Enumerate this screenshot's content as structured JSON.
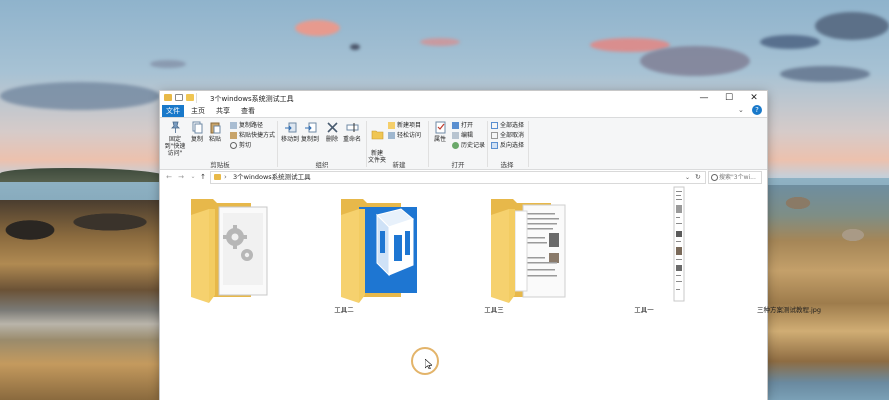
{
  "window": {
    "title": "3个windows系统测试工具",
    "controls": {
      "minimize": "—",
      "maximize": "☐",
      "close": "✕"
    }
  },
  "ribbon_tabs": {
    "file": "文件",
    "home": "主页",
    "share": "共享",
    "view": "查看",
    "expand": "⌄",
    "help": "?"
  },
  "ribbon": {
    "clipboard": {
      "group_label": "剪贴板",
      "pin_quick_access": "固定到\"快速访问\"",
      "copy": "复制",
      "paste": "粘贴",
      "copy_path": "复制路径",
      "paste_shortcut": "粘贴快捷方式",
      "cut": "剪切"
    },
    "organize": {
      "group_label": "组织",
      "move_to": "移动到",
      "copy_to": "复制到",
      "delete": "删除",
      "rename": "重命名"
    },
    "new": {
      "group_label": "新建",
      "new_folder": "新建\n文件夹",
      "new_item": "新建项目",
      "easy_access": "轻松访问"
    },
    "open": {
      "group_label": "打开",
      "properties": "属性",
      "open": "打开",
      "edit": "编辑",
      "history": "历史记录"
    },
    "select": {
      "group_label": "选择",
      "select_all": "全部选择",
      "select_none": "全部取消",
      "invert": "反向选择"
    }
  },
  "address": {
    "path": "3个windows系统测试工具",
    "search_placeholder": "搜索\"3个wi...",
    "separator": "›"
  },
  "nav": {
    "back": "←",
    "forward": "→",
    "recent": "⌄",
    "up": "↑"
  },
  "items": [
    {
      "label": "工具二",
      "type": "folder",
      "preview": "gears"
    },
    {
      "label": "工具三",
      "type": "folder",
      "preview": "blue-cube"
    },
    {
      "label": "工具一",
      "type": "folder",
      "preview": "documents"
    },
    {
      "label": "三种方案测试教程.jpg",
      "type": "image",
      "preview": "tall-screenshot"
    }
  ],
  "colors": {
    "accent": "#1979ca",
    "folder_yellow": "#f3cc62",
    "cube_blue": "#1e76d2"
  }
}
